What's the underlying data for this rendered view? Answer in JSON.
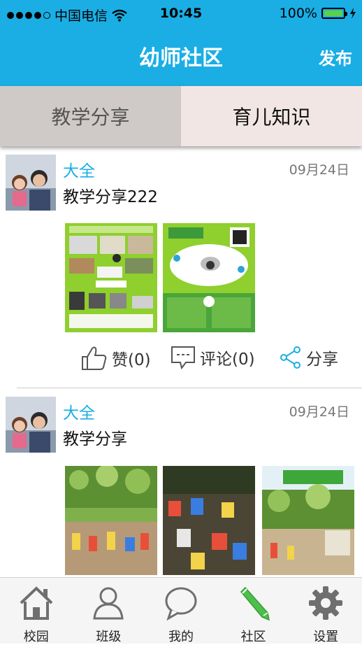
{
  "status_bar": {
    "carrier": "中国电信",
    "time": "10:45",
    "battery": "100%"
  },
  "nav": {
    "title": "幼师社区",
    "publish_label": "发布"
  },
  "tabs": [
    {
      "label": "教学分享",
      "selected": false
    },
    {
      "label": "育儿知识",
      "selected": true
    }
  ],
  "posts": [
    {
      "username": "大全",
      "date": "09月24日",
      "content": "教学分享222",
      "images": [
        "教学设备宣传海报",
        "云视频服务宣传海报"
      ],
      "actions": {
        "like": "赞(0)",
        "comment": "评论(0)",
        "share": "分享"
      }
    },
    {
      "username": "大全",
      "date": "09月24日",
      "content": "教学分享",
      "images": [
        "幼儿园户外活动照片",
        "儿童写生活动照片",
        "生态游乐园照片"
      ]
    }
  ],
  "tabbar": [
    {
      "label": "校园",
      "icon": "home-icon"
    },
    {
      "label": "班级",
      "icon": "person-icon"
    },
    {
      "label": "我的",
      "icon": "chat-bubble-icon"
    },
    {
      "label": "社区",
      "icon": "pencil-icon"
    },
    {
      "label": "设置",
      "icon": "gear-icon"
    }
  ],
  "colors": {
    "accent": "#1aaee5",
    "active_tab_green": "#4cc04a"
  }
}
